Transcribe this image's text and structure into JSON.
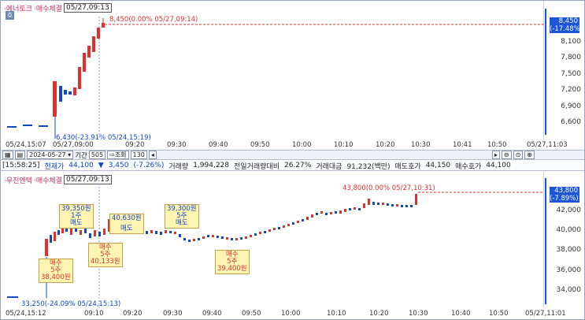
{
  "top_chart": {
    "legend": {
      "a": "·에너토크",
      "b": "·매수체결",
      "date": "05/27,09:13"
    },
    "icon": "호",
    "current_note": "8,450(0.00% 05/27,09:14)",
    "low_note": "6,430(-23.91% 05/24,15:19)",
    "price_box": {
      "price": "8,450",
      "change": "(-17.48%)"
    },
    "y_ticks": [
      "8,100",
      "7,800",
      "7,500",
      "7,200",
      "6,900",
      "6,600"
    ],
    "x_ticks": [
      "05/24,15:07",
      "05/27,09:00",
      "09:20",
      "09:30",
      "09:40",
      "09:50",
      "10:00",
      "10:10",
      "10:20",
      "10:30",
      "10:41",
      "10:50",
      "05/27,11:03"
    ]
  },
  "toolbar": {
    "date": "2024-05-27",
    "period_label": "기간",
    "count": "505",
    "query": "조회",
    "zoom": "130"
  },
  "infobar": {
    "time": "[15:58:25]",
    "label_price": "현재가",
    "price": "44,100",
    "arrow": "▼",
    "change": "3,450",
    "change_pct": "(-7.26%)",
    "volume_label": "거래량",
    "volume": "1,994,228",
    "prev_ratio_label": "전일거래량대비",
    "prev_ratio": "26.27%",
    "amount_label": "거래대금",
    "amount": "91,232(백만)",
    "ask_label": "매도호가",
    "ask": "44,150",
    "bid_label": "매수호가",
    "bid": "44,100"
  },
  "bottom_chart": {
    "legend": {
      "a": "·우진엔텍",
      "b": "·매수체결",
      "date": "05/27,09:13"
    },
    "current_note": "43,800(0.00% 05/27,10:31)",
    "low_note": "33,250(-24.09% 05/24,15:13)",
    "price_box": {
      "price": "43,800",
      "change": "(-7.89%)"
    },
    "y_ticks": [
      "42,000",
      "40,000",
      "38,000",
      "36,000",
      "34,000"
    ],
    "x_ticks": [
      "05/24,15:12",
      "09:10",
      "09:20",
      "09:30",
      "09:40",
      "09:50",
      "10:00",
      "10:10",
      "10:20",
      "10:30",
      "10:40",
      "10:50",
      "05/27,11:01"
    ],
    "callouts": [
      {
        "l1": "39,350원",
        "l2": "1주",
        "l3": "매도"
      },
      {
        "l1": "40,630원",
        "l2": "",
        "l3": "매도"
      },
      {
        "l1": "39,300원",
        "l2": "5주",
        "l3": "매도"
      },
      {
        "l1": "매수",
        "l2": "5주",
        "l3": "38,400원"
      },
      {
        "l1": "매수",
        "l2": "5주",
        "l3": "40,133원"
      },
      {
        "l1": "매수",
        "l2": "5주",
        "l3": "39,400원"
      }
    ]
  }
}
